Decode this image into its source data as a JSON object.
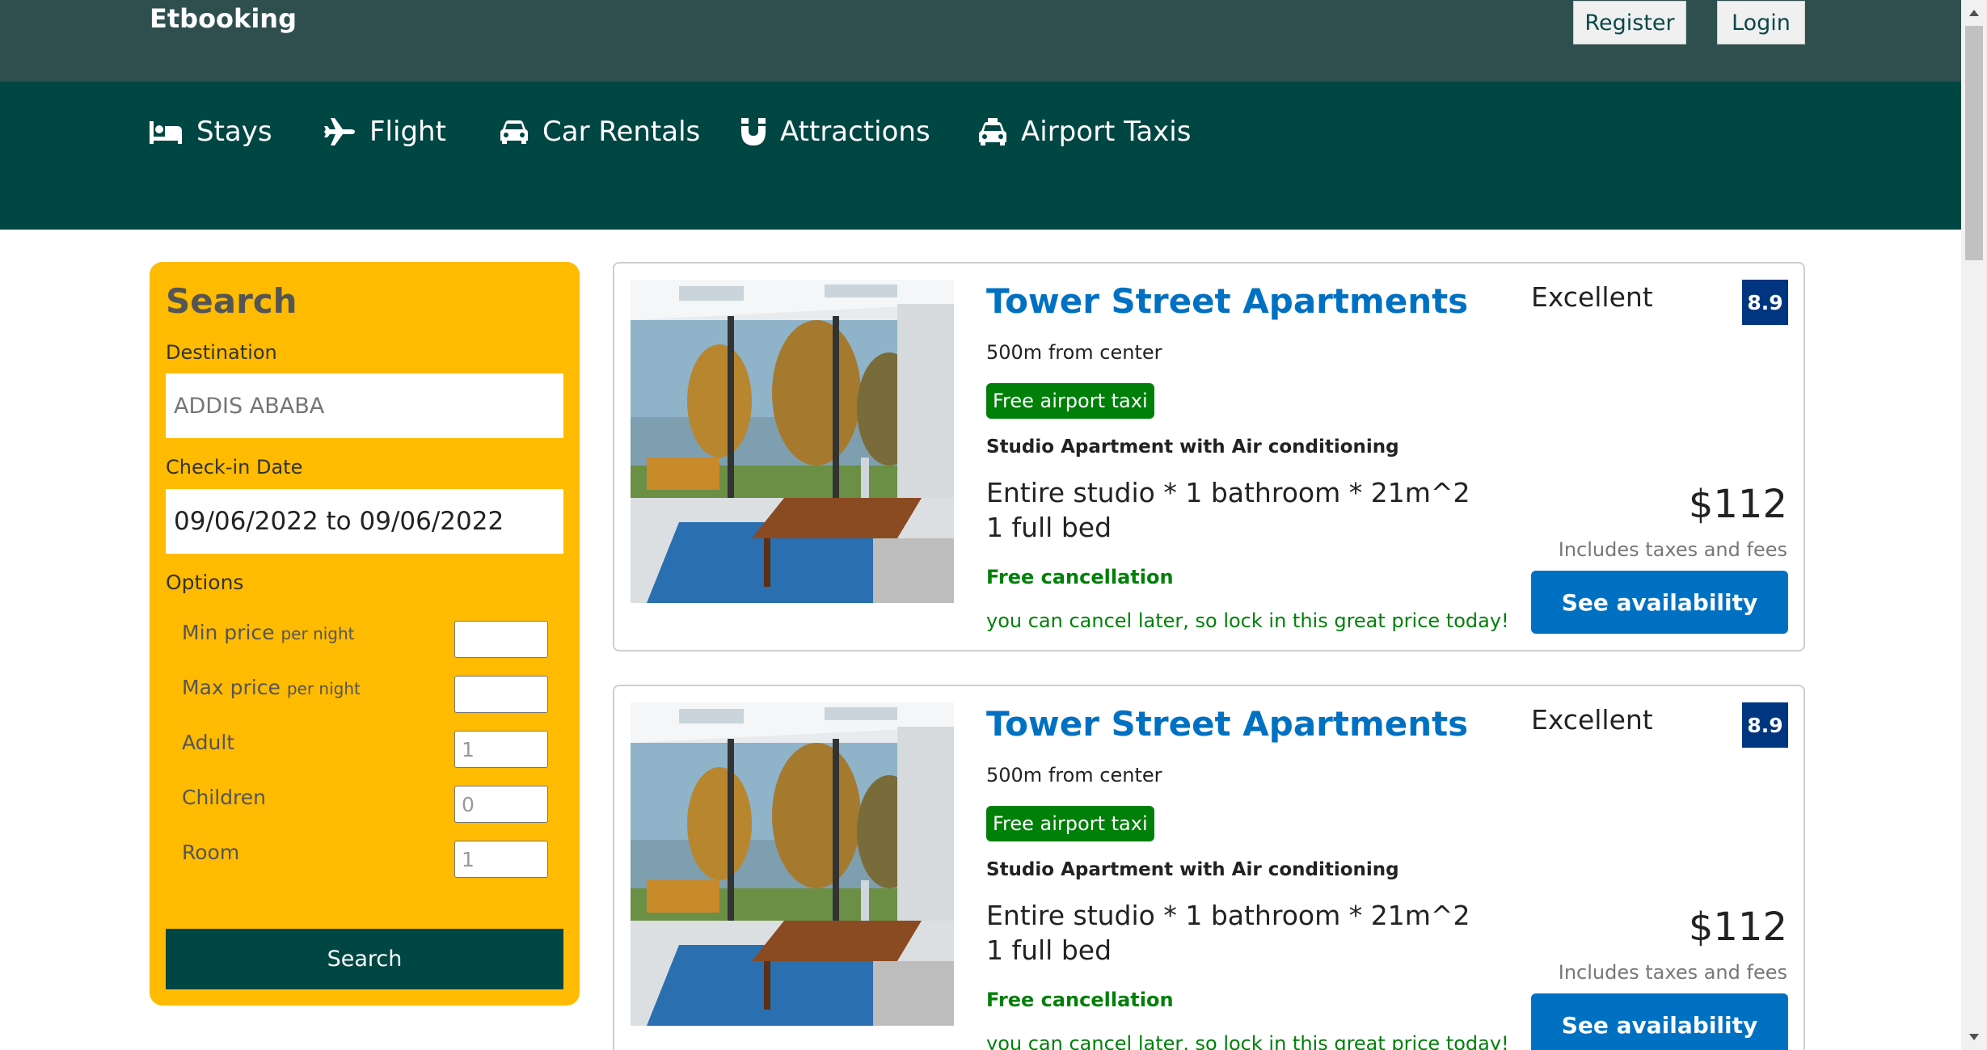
{
  "header": {
    "logo": "Etbooking",
    "register_label": "Register",
    "login_label": "Login"
  },
  "nav": {
    "items": [
      {
        "label": "Stays",
        "icon": "bed-icon"
      },
      {
        "label": "Flight",
        "icon": "plane-icon"
      },
      {
        "label": "Car Rentals",
        "icon": "car-icon"
      },
      {
        "label": "Attractions",
        "icon": "magnet-icon"
      },
      {
        "label": "Airport Taxis",
        "icon": "taxi-icon"
      }
    ]
  },
  "search": {
    "title": "Search",
    "destination_label": "Destination",
    "destination_placeholder": "ADDIS ABABA",
    "checkin_label": "Check-in Date",
    "checkin_value": "09/06/2022 to 09/06/2022",
    "options_label": "Options",
    "per_night": "per night",
    "options": [
      {
        "label": "Min price",
        "value": ""
      },
      {
        "label": "Max price",
        "value": ""
      },
      {
        "label": "Adult",
        "value": "1"
      },
      {
        "label": "Children",
        "value": "0"
      },
      {
        "label": "Room",
        "value": "1"
      }
    ],
    "button_label": "Search"
  },
  "results": [
    {
      "title": "Tower Street Apartments",
      "distance": "500m from center",
      "taxi_badge": "Free airport taxi",
      "subtitle": "Studio Apartment with Air conditioning",
      "features": "Entire studio * 1 bathroom * 21m^2 1 full bed",
      "cancel": "Free cancellation",
      "cancel_sub": "you can cancel later, so lock in this great price today!",
      "rating_text": "Excellent",
      "rating": "8.9",
      "price": "$112",
      "taxes": "Includes taxes and fees",
      "button": "See availability"
    },
    {
      "title": "Tower Street Apartments",
      "distance": "500m from center",
      "taxi_badge": "Free airport taxi",
      "subtitle": "Studio Apartment with Air conditioning",
      "features": "Entire studio * 1 bathroom * 21m^2 1 full bed",
      "cancel": "Free cancellation",
      "cancel_sub": "you can cancel later, so lock in this great price today!",
      "rating_text": "Excellent",
      "rating": "8.9",
      "price": "$112",
      "taxes": "Includes taxes and fees",
      "button": "See availability"
    }
  ],
  "colors": {
    "topbar": "#2f4f4f",
    "nav": "#004643",
    "search_panel": "#febb02",
    "title_blue": "#0071c2",
    "rating_badge": "#003580",
    "green": "#008009"
  }
}
